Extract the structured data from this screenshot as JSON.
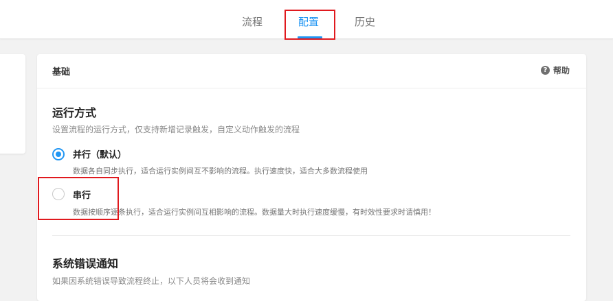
{
  "tabs": [
    {
      "label": "流程",
      "active": false
    },
    {
      "label": "配置",
      "active": true
    },
    {
      "label": "历史",
      "active": false
    }
  ],
  "card": {
    "title": "基础",
    "help_label": "帮助",
    "help_icon": "?"
  },
  "run_mode": {
    "title": "运行方式",
    "description": "设置流程的运行方式，仅支持新增记录触发，自定义动作触发的流程",
    "options": [
      {
        "label": "并行（默认）",
        "description": "数据各自同步执行，适合运行实例间互不影响的流程。执行速度快，适合大多数流程使用",
        "selected": true
      },
      {
        "label": "串行",
        "description": "数据按顺序逐条执行，适合运行实例间互相影响的流程。数据量大时执行速度缓慢，有时效性要求时请慎用！",
        "selected": false
      }
    ]
  },
  "error_notify": {
    "title": "系统错误通知",
    "description": "如果因系统错误导致流程终止，以下人员将会收到通知"
  },
  "colors": {
    "accent": "#2196f3",
    "highlight": "#e0191e"
  }
}
